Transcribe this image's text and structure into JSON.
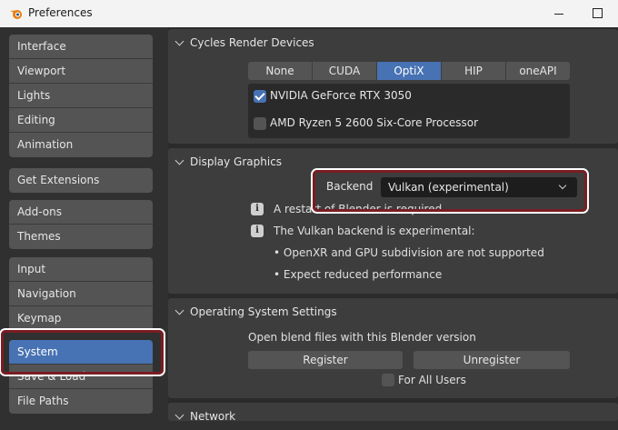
{
  "window": {
    "title": "Preferences"
  },
  "sidebar": {
    "groups": [
      {
        "items": [
          "Interface",
          "Viewport",
          "Lights",
          "Editing",
          "Animation"
        ]
      },
      {
        "items": [
          "Get Extensions"
        ]
      },
      {
        "items": [
          "Add-ons",
          "Themes"
        ]
      },
      {
        "items": [
          "Input",
          "Navigation",
          "Keymap"
        ]
      },
      {
        "items": [
          "System",
          "Save & Load",
          "File Paths"
        ]
      }
    ],
    "active": "System"
  },
  "cycles": {
    "title": "Cycles Render Devices",
    "tabs": [
      "None",
      "CUDA",
      "OptiX",
      "HIP",
      "oneAPI"
    ],
    "active_tab": "OptiX",
    "devices": [
      {
        "name": "NVIDIA GeForce RTX 3050",
        "checked": true
      },
      {
        "name": "AMD Ryzen 5 2600 Six-Core Processor",
        "checked": false
      }
    ]
  },
  "display": {
    "title": "Display Graphics",
    "backend_label": "Backend",
    "backend_value": "Vulkan (experimental)",
    "notice1": "A restart of Blender is required",
    "notice2": "The Vulkan backend is experimental:",
    "bullet1": "• OpenXR and GPU subdivision are not supported",
    "bullet2": "• Expect reduced performance"
  },
  "os": {
    "title": "Operating System Settings",
    "text": "Open blend files with this Blender version",
    "register": "Register",
    "unregister": "Unregister",
    "for_all_users": "For All Users"
  },
  "network": {
    "title": "Network"
  },
  "colors": {
    "accent": "#4772b3",
    "highlight": "#7a1d22"
  },
  "icons": {
    "app": "blender-icon",
    "info": "info-icon",
    "check": "checkmark-icon",
    "chevron": "chevron-down-icon"
  }
}
